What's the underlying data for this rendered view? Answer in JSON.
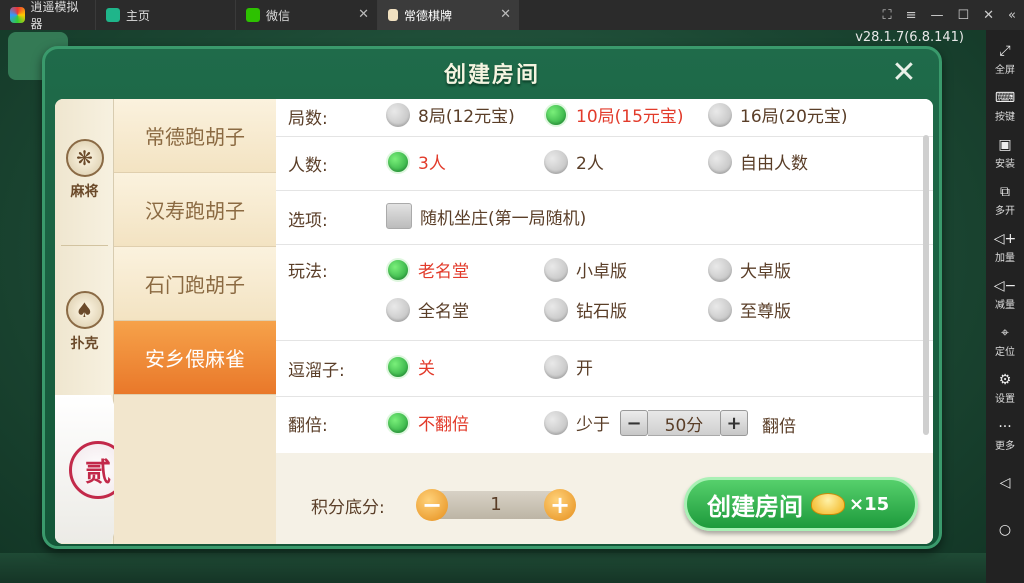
{
  "titlebar": {
    "app_name": "逍遥模拟器",
    "tabs": [
      {
        "label": "主页"
      },
      {
        "label": "微信",
        "close": "✕"
      },
      {
        "label": "常德棋牌",
        "close": "✕"
      }
    ]
  },
  "sidebar": {
    "items": [
      {
        "label": "全屏",
        "icon": "fullscreen-icon"
      },
      {
        "label": "按键",
        "icon": "keyboard-icon"
      },
      {
        "label": "安装",
        "icon": "apk-icon"
      },
      {
        "label": "多开",
        "icon": "multi-open-icon"
      },
      {
        "label": "加量",
        "icon": "volume-up-icon"
      },
      {
        "label": "减量",
        "icon": "volume-down-icon"
      },
      {
        "label": "定位",
        "icon": "location-icon"
      },
      {
        "label": "设置",
        "icon": "gear-icon"
      },
      {
        "label": "更多",
        "icon": "more-icon"
      }
    ]
  },
  "game": {
    "version": "v28.1.7(6.8.141)"
  },
  "dialog": {
    "title": "创建房间",
    "categories": [
      {
        "label": "麻将",
        "icon": "mahjong-icon"
      },
      {
        "label": "扑克",
        "icon": "spade-icon"
      },
      {
        "label": "贰",
        "icon": "er-badge-icon"
      }
    ],
    "games": [
      "常德跑胡子",
      "汉寿跑胡子",
      "石门跑胡子",
      "安乡偎麻雀"
    ],
    "active_game_index": 3,
    "rows": {
      "rounds": {
        "label": "局数:",
        "options": [
          "8局(12元宝)",
          "10局(15元宝)",
          "16局(20元宝)"
        ],
        "selected": 1
      },
      "players": {
        "label": "人数:",
        "options": [
          "3人",
          "2人",
          "自由人数"
        ],
        "selected": 0
      },
      "choice": {
        "label": "选项:",
        "checkbox_label": "随机坐庄(第一局随机)",
        "checked": false
      },
      "play": {
        "label": "玩法:",
        "options": [
          "老名堂",
          "小卓版",
          "大卓版",
          "全名堂",
          "钻石版",
          "至尊版"
        ],
        "selected": 0
      },
      "douliuzi": {
        "label": "逗溜子:",
        "options": [
          "关",
          "开"
        ],
        "selected": 0
      },
      "double": {
        "label": "翻倍:",
        "options": [
          "不翻倍",
          "少于"
        ],
        "selected": 0,
        "stepper_value": "50分",
        "suffix": "翻倍",
        "minus": "−",
        "plus": "+"
      }
    },
    "score": {
      "label": "积分底分:",
      "value": "1",
      "minus": "−",
      "plus": "+"
    },
    "create_button": {
      "label": "创建房间",
      "cost": "×15"
    },
    "close": "✕"
  }
}
